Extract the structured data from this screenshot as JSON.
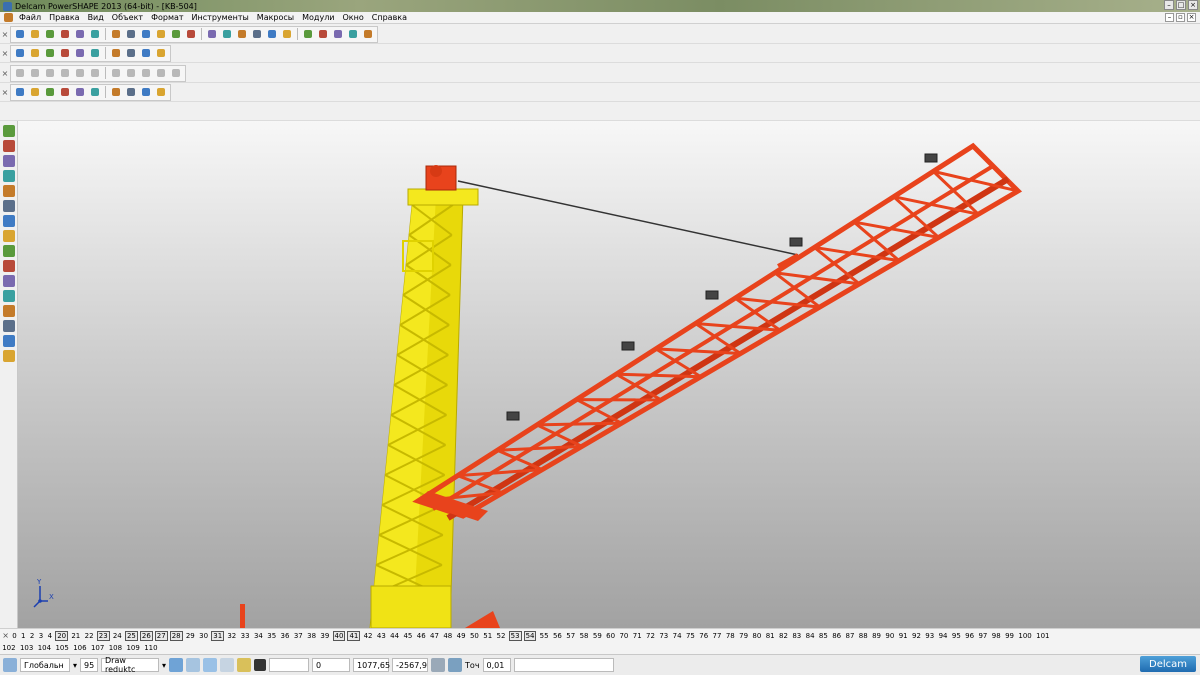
{
  "window": {
    "title": "Delcam PowerSHAPE 2013 (64-bit) - [KB-504]"
  },
  "menu": {
    "items": [
      "Файл",
      "Правка",
      "Вид",
      "Объект",
      "Формат",
      "Инструменты",
      "Макросы",
      "Модули",
      "Окно",
      "Справка"
    ]
  },
  "toolbars": {
    "row1": {
      "icons": [
        "new-icon",
        "open-icon",
        "save-icon",
        "print-icon",
        "cut-icon",
        "copy-icon",
        "paste-icon",
        "undo-icon",
        "redo-icon",
        "zoom-icon",
        "zoom-box-icon",
        "rotate-icon",
        "pan-icon",
        "shade-icon",
        "wireframe-icon",
        "select-icon",
        "line-icon",
        "arc-icon",
        "curve-icon",
        "text-icon",
        "surface-icon",
        "solid-icon",
        "measure-icon"
      ]
    },
    "row2": {
      "icons": [
        "calculator-icon",
        "doc-icon",
        "layer-icon",
        "sphere-icon",
        "cone-icon",
        "block-icon",
        "cylinder-icon",
        "render-icon",
        "export-icon",
        "material-icon"
      ]
    },
    "row3": {
      "icons": [
        "curve-edit-icon",
        "fillet-icon",
        "chamfer-icon",
        "trim-icon",
        "extend-icon",
        "offset-icon",
        "blend-icon",
        "spline-icon",
        "helix-icon",
        "wrap-icon",
        "frame-icon"
      ]
    },
    "row4": {
      "icons": [
        "solid-extrude-icon",
        "solid-revolve-icon",
        "solid-sweep-icon",
        "boolean-add-icon",
        "boolean-subtract-icon",
        "shell-icon",
        "cut-solid-icon",
        "feature-icon",
        "assembly-icon",
        "mate-icon"
      ]
    }
  },
  "viewport": {
    "axis_x": "X",
    "axis_y": "Y",
    "tower_color": "#f2e40c",
    "jib_color": "#e8431c"
  },
  "levels": {
    "row1": [
      "0",
      "1",
      "2",
      "3",
      "4",
      "20",
      "21",
      "22",
      "23",
      "24",
      "25",
      "26",
      "27",
      "28",
      "29",
      "30",
      "31",
      "32",
      "33",
      "34",
      "35",
      "36",
      "37",
      "38",
      "39",
      "40",
      "41",
      "42",
      "43",
      "44",
      "45",
      "46",
      "47",
      "48",
      "49",
      "50",
      "51",
      "52",
      "53",
      "54",
      "55",
      "56",
      "57",
      "58",
      "59",
      "60",
      "70",
      "71",
      "72",
      "73",
      "74",
      "75",
      "76",
      "77",
      "78",
      "79",
      "80",
      "81",
      "82",
      "83",
      "84",
      "85",
      "86",
      "87",
      "88",
      "89",
      "90",
      "91",
      "92",
      "93",
      "94",
      "95",
      "96",
      "97",
      "98",
      "99",
      "100",
      "101"
    ],
    "boxed": [
      "20",
      "23",
      "25",
      "26",
      "27",
      "28",
      "31",
      "40",
      "41",
      "53",
      "54"
    ],
    "row2": [
      "102",
      "103",
      "104",
      "105",
      "106",
      "107",
      "108",
      "109",
      "110"
    ]
  },
  "status": {
    "workplane": "Глобальн",
    "level_num": "95",
    "level_name": "Draw reduktc",
    "value1": "",
    "value2": "0",
    "coord_x": "1077,65",
    "coord_y": "-2567,9",
    "tolerance_label": "Точ",
    "tolerance_value": "0,01",
    "logo": "Delcam"
  }
}
